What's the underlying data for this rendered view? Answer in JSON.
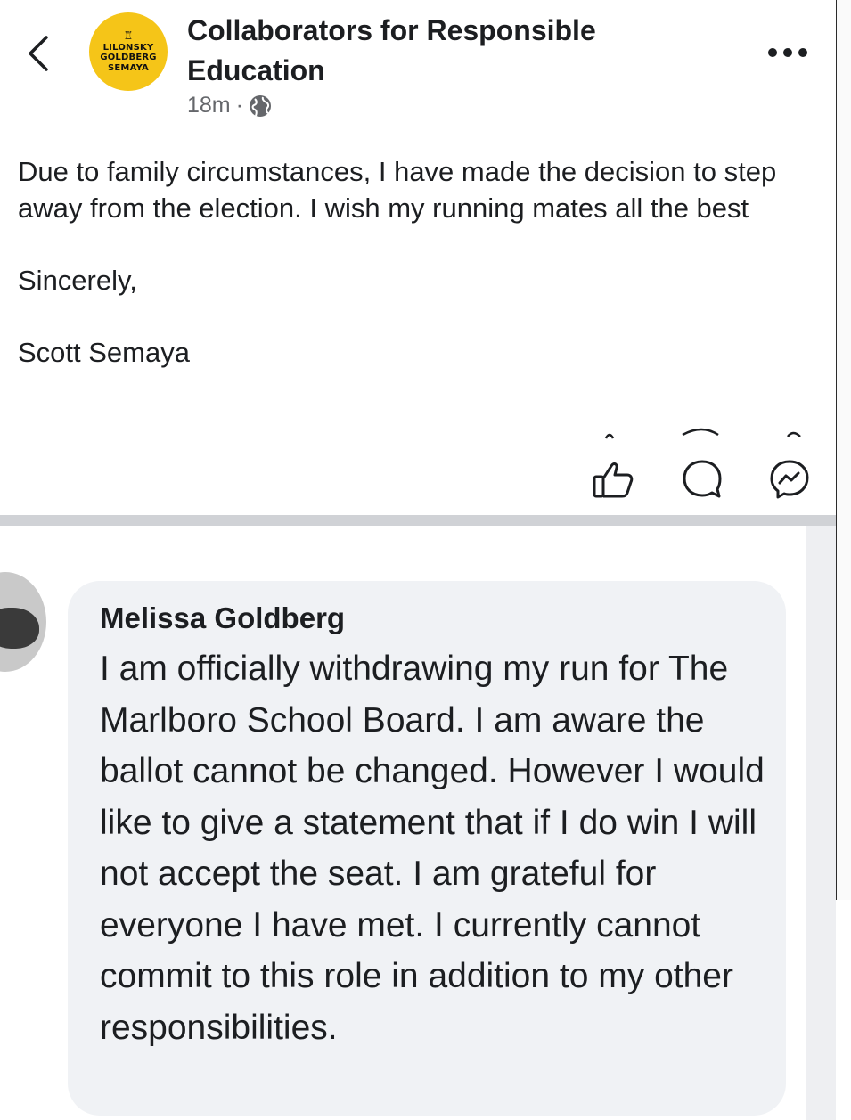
{
  "post": {
    "page_name": "Collaborators for Responsible Education",
    "avatar_badge_lines": [
      "LILONSKY",
      "GOLDBERG",
      "SEMAYA"
    ],
    "time": "18m",
    "separator": "·",
    "visibility_icon": "globe-icon",
    "paragraphs": [
      "Due to family circumstances, I have made the decision to step away from the election.  I wish my running mates all the best",
      "Sincerely,",
      "Scott Semaya"
    ]
  },
  "actions": {
    "icons": [
      "thumbs-up-icon",
      "comment-icon",
      "messenger-icon"
    ]
  },
  "comment": {
    "author": "Melissa Goldberg",
    "text": "I am officially withdrawing my run for The Marlboro School Board. I am aware the ballot cannot be changed. However I would like to give a statement that if I do win I will not accept the seat. I am grateful for everyone I have met. I currently cannot commit to this role in addition to my other responsibilities."
  },
  "colors": {
    "text": "#1c1e21",
    "meta": "#65676b",
    "badge": "#f5c518",
    "bubble": "#f0f2f5",
    "divider": "#d0d2d6"
  }
}
